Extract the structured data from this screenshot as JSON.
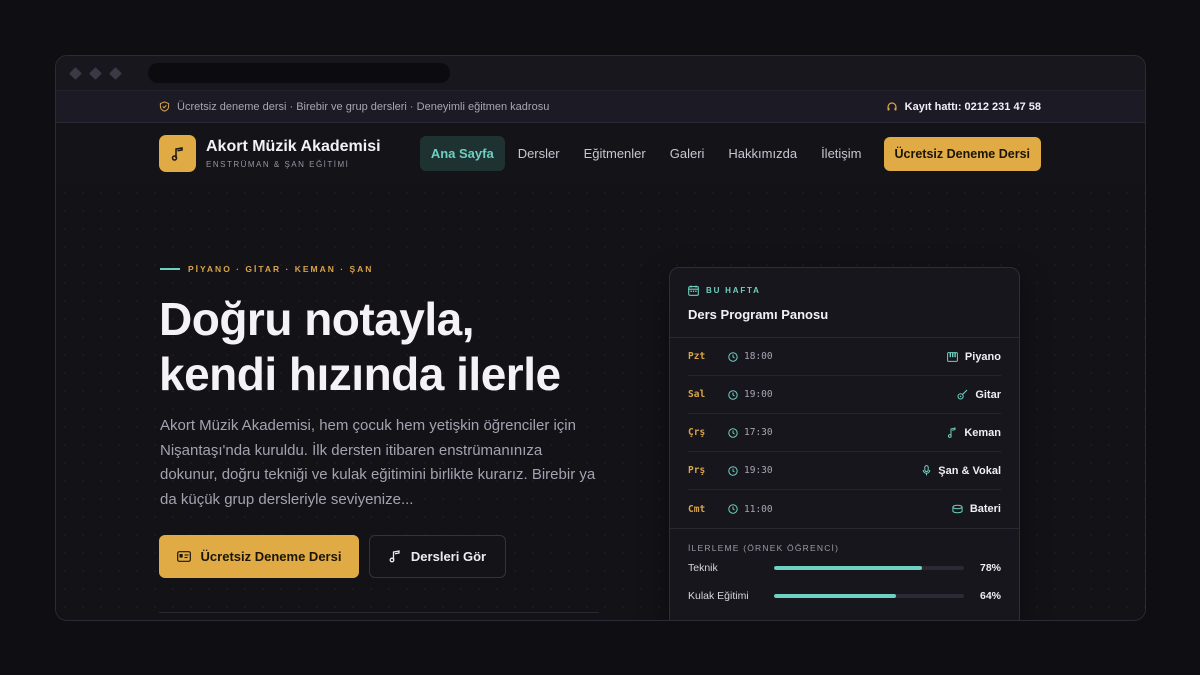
{
  "topbar": {
    "info": "Ücretsiz deneme dersi · Birebir ve grup dersleri · Deneyimli eğitmen kadrosu",
    "hotline": "Kayıt hattı: 0212 231 47 58"
  },
  "brand": {
    "title": "Akort Müzik Akademisi",
    "subtitle": "ENSTRÜMAN & ŞAN EĞİTİMİ",
    "icon": "music-note-icon"
  },
  "nav": {
    "items": [
      {
        "label": "Ana Sayfa",
        "active": true
      },
      {
        "label": "Dersler"
      },
      {
        "label": "Eğitmenler"
      },
      {
        "label": "Galeri"
      },
      {
        "label": "Hakkımızda"
      },
      {
        "label": "İletişim"
      }
    ],
    "cta": "Ücretsiz Deneme Dersi"
  },
  "hero": {
    "eyebrow": "PİYANO · GİTAR · KEMAN · ŞAN",
    "headline_line1": "Doğru notayla,",
    "headline_line2": "kendi hızında ilerle",
    "lead": "Akort Müzik Akademisi, hem çocuk hem yetişkin öğrenciler için Nişantaşı'nda kuruldu. İlk dersten itibaren enstrümanınıza dokunur, doğru tekniği ve kulak eğitimini birlikte kurarız. Birebir ya da küçük grup dersleriyle seviyenize...",
    "primary_button": "Ücretsiz Deneme Dersi",
    "secondary_button": "Dersleri Gör"
  },
  "panel": {
    "kicker": "BU HAFTA",
    "title": "Ders Programı Panosu",
    "schedule": [
      {
        "day": "Pzt",
        "time": "18:00",
        "instrument": "Piyano",
        "icon": "piano-icon"
      },
      {
        "day": "Sal",
        "time": "19:00",
        "instrument": "Gitar",
        "icon": "guitar-icon"
      },
      {
        "day": "Çrş",
        "time": "17:30",
        "instrument": "Keman",
        "icon": "violin-icon"
      },
      {
        "day": "Prş",
        "time": "19:30",
        "instrument": "Şan & Vokal",
        "icon": "microphone-icon"
      },
      {
        "day": "Cmt",
        "time": "11:00",
        "instrument": "Bateri",
        "icon": "drum-icon"
      }
    ],
    "progress_label": "İLERLEME (ÖRNEK ÖĞRENCİ)",
    "progress": [
      {
        "name": "Teknik",
        "value": 78,
        "value_label": "78%"
      },
      {
        "name": "Kulak Eğitimi",
        "value": 64,
        "value_label": "64%"
      }
    ]
  },
  "colors": {
    "accent_gold": "#e0aa45",
    "accent_teal": "#6fcfc0",
    "background": "#131217"
  }
}
